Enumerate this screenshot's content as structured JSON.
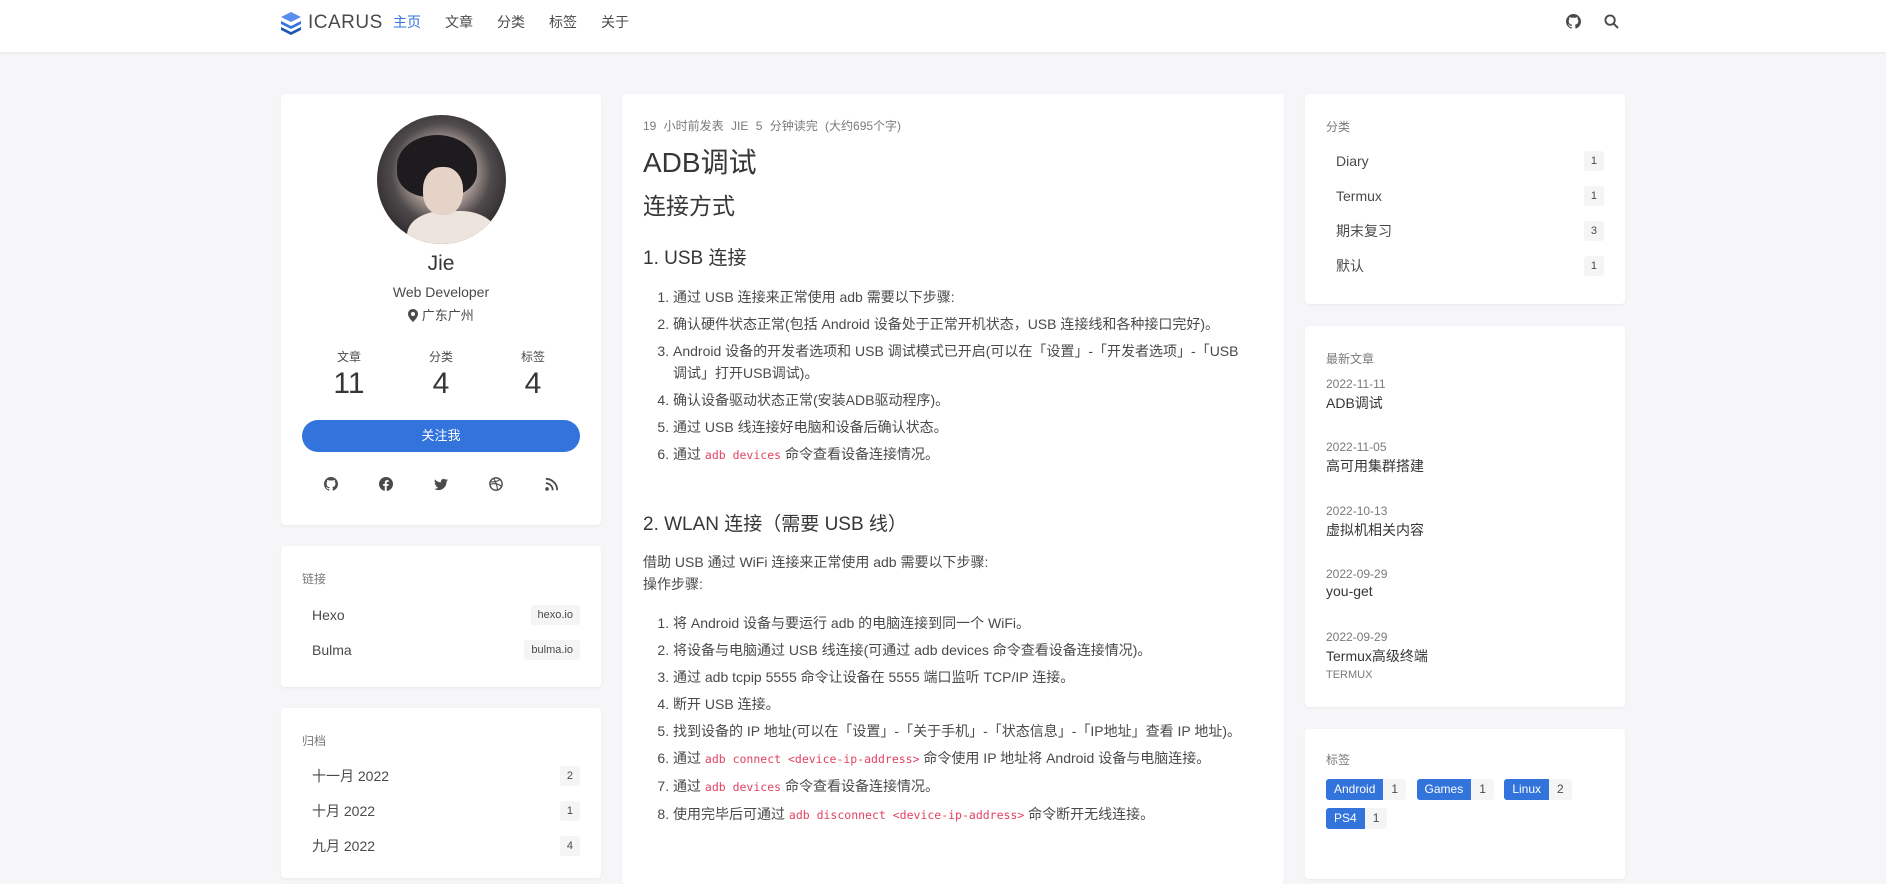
{
  "brand": {
    "name": "ICARUS"
  },
  "nav": {
    "items": [
      "主页",
      "文章",
      "分类",
      "标签",
      "关于"
    ]
  },
  "profile": {
    "name": "Jie",
    "role": "Web Developer",
    "location": "广东广州",
    "stats": [
      {
        "label": "文章",
        "value": "11"
      },
      {
        "label": "分类",
        "value": "4"
      },
      {
        "label": "标签",
        "value": "4"
      }
    ],
    "follow_label": "关注我",
    "social_icons": [
      "github-icon",
      "facebook-icon",
      "twitter-icon",
      "dribbble-icon",
      "rss-icon"
    ]
  },
  "links": {
    "label": "链接",
    "items": [
      {
        "name": "Hexo",
        "tag": "hexo.io"
      },
      {
        "name": "Bulma",
        "tag": "bulma.io"
      }
    ]
  },
  "archives": {
    "label": "归档",
    "items": [
      {
        "name": "十一月 2022",
        "count": "2"
      },
      {
        "name": "十月 2022",
        "count": "1"
      },
      {
        "name": "九月 2022",
        "count": "4"
      }
    ]
  },
  "article": {
    "meta": "19 小时前发表   JIE   5 分钟读完 (大约695个字)",
    "title": "ADB调试",
    "h_connect": "连接方式",
    "h_usb": "1. USB 连接",
    "usb_steps": [
      "通过 USB 连接来正常使用 adb 需要以下步骤:",
      "确认硬件状态正常(包括 Android 设备处于正常开机状态，USB 连接线和各种接口完好)。",
      "Android 设备的开发者选项和 USB 调试模式已开启(可以在「设置」-「开发者选项」-「USB调试」打开USB调试)。",
      "确认设备驱动状态正常(安装ADB驱动程序)。",
      "通过 USB 线连接好电脑和设备后确认状态。"
    ],
    "usb_step6": {
      "pre": "通过 ",
      "code": "adb devices",
      "post": " 命令查看设备连接情况。"
    },
    "h_wlan": "2. WLAN 连接（需要 USB 线）",
    "wlan_intro_1": "借助 USB 通过 WiFi 连接来正常使用 adb 需要以下步骤:",
    "wlan_intro_2": "操作步骤:",
    "wlan_steps": [
      "将 Android 设备与要运行 adb 的电脑连接到同一个 WiFi。",
      "将设备与电脑通过 USB 线连接(可通过 adb devices 命令查看设备连接情况)。",
      "通过 adb tcpip 5555 命令让设备在 5555 端口监听 TCP/IP 连接。",
      "断开 USB 连接。",
      "找到设备的 IP 地址(可以在「设置」-「关于手机」-「状态信息」-「IP地址」查看 IP 地址)。"
    ],
    "wlan_step6": {
      "pre": "通过 ",
      "code": "adb connect <device-ip-address>",
      "post": " 命令使用 IP 地址将 Android 设备与电脑连接。"
    },
    "wlan_step7": {
      "pre": "通过 ",
      "code": "adb devices",
      "post": " 命令查看设备连接情况。"
    },
    "wlan_step8": {
      "pre": "使用完毕后可通过 ",
      "code": "adb disconnect <device-ip-address>",
      "post": " 命令断开无线连接。"
    }
  },
  "categories": {
    "label": "分类",
    "items": [
      {
        "name": "Diary",
        "count": "1"
      },
      {
        "name": "Termux",
        "count": "1"
      },
      {
        "name": "期末复习",
        "count": "3"
      },
      {
        "name": "默认",
        "count": "1"
      }
    ]
  },
  "recent": {
    "label": "最新文章",
    "items": [
      {
        "date": "2022-11-11",
        "title": "ADB调试",
        "category": ""
      },
      {
        "date": "2022-11-05",
        "title": "高可用集群搭建",
        "category": ""
      },
      {
        "date": "2022-10-13",
        "title": "虚拟机相关内容",
        "category": ""
      },
      {
        "date": "2022-09-29",
        "title": "you-get",
        "category": ""
      },
      {
        "date": "2022-09-29",
        "title": "Termux高级终端",
        "category": "TERMUX"
      }
    ]
  },
  "tags": {
    "label": "标签",
    "items": [
      {
        "name": "Android",
        "count": "1"
      },
      {
        "name": "Games",
        "count": "1"
      },
      {
        "name": "Linux",
        "count": "2"
      },
      {
        "name": "PS4",
        "count": "1"
      }
    ]
  },
  "colors": {
    "accent": "#3273dc",
    "code": "#e34262",
    "background": "#f6f6f8"
  }
}
